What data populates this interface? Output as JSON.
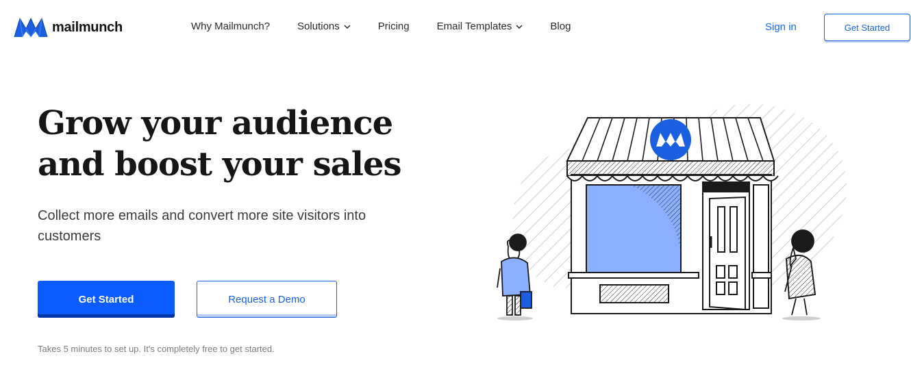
{
  "header": {
    "logo_text": "mailmunch",
    "nav": [
      {
        "label": "Why Mailmunch?",
        "has_dropdown": false
      },
      {
        "label": "Solutions",
        "has_dropdown": true
      },
      {
        "label": "Pricing",
        "has_dropdown": false
      },
      {
        "label": "Email Templates",
        "has_dropdown": true
      },
      {
        "label": "Blog",
        "has_dropdown": false
      }
    ],
    "sign_in": "Sign in",
    "get_started": "Get Started"
  },
  "hero": {
    "title_line1": "Grow your audience",
    "title_line2": "and boost your sales",
    "subtitle": "Collect more emails and convert more site visitors into customers",
    "primary_cta": "Get Started",
    "secondary_cta": "Request a Demo",
    "note": "Takes 5 minutes to set up. It's completely free to get started."
  },
  "icons": {
    "logo": "mailmunch-logo-icon",
    "dropdown": "chevron-down-icon",
    "storefront": "storefront-illustration"
  },
  "colors": {
    "brand_blue": "#0a5cff",
    "link_blue": "#1a66e8",
    "light_blue": "#7aa7ff",
    "text_dark": "#161616"
  }
}
